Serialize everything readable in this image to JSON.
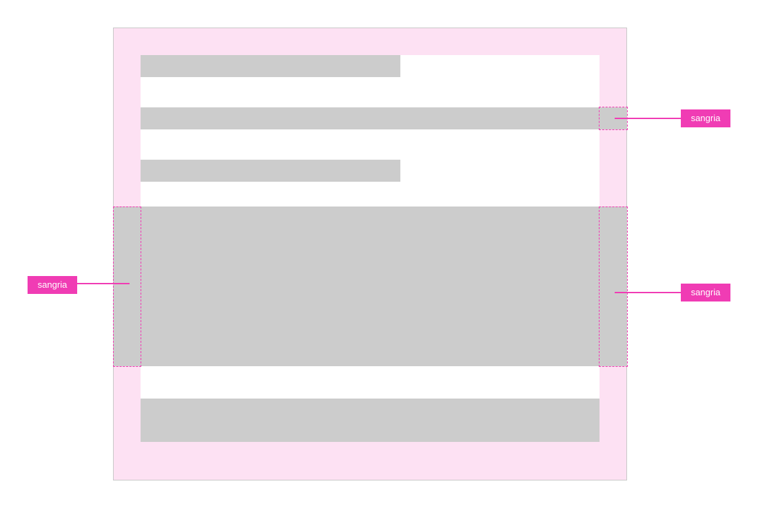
{
  "annotations": {
    "top_right": "sangria",
    "middle_left": "sangria",
    "middle_right": "sangria"
  },
  "colors": {
    "bleed_area": "#fde1f3",
    "content_block": "#cccccc",
    "annotation": "#f03cb4",
    "frame_border": "#c9c9c9"
  }
}
